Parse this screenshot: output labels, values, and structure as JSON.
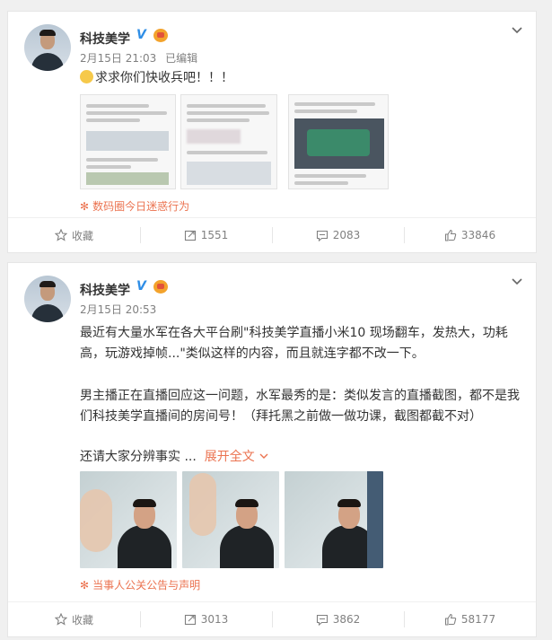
{
  "post1": {
    "username": "科技美学",
    "verified_badge": "V",
    "date": "2月15日 21:03",
    "edited": "已编辑",
    "text": "求求你们快收兵吧！！！",
    "source": "数码圈今日迷惑行为",
    "actions": {
      "favorite": "收藏",
      "repost": "1551",
      "comment": "2083",
      "like": "33846"
    }
  },
  "post2": {
    "username": "科技美学",
    "verified_badge": "V",
    "date": "2月15日 20:53",
    "para1_line1": "最近有大量水军在各大平台刷\"科技美学直播小米10 现场翻车，发热大，功耗",
    "para1_line2": "高，玩游戏掉帧...\"类似这样的内容，而且就连字都不改一下。",
    "para2_line1": "男主播正在直播回应这一问题，水军最秀的是：类似发言的直播截图，都不是我",
    "para2_line2": "们科技美学直播间的房间号！（拜托黑之前做一做功课，截图都截不对）",
    "para3": "还请大家分辨事实 ...",
    "expand": "展开全文",
    "source": "当事人公关公告与声明",
    "actions": {
      "favorite": "收藏",
      "repost": "3013",
      "comment": "3862",
      "like": "58177"
    }
  },
  "colors": {
    "accent": "#eb7350",
    "verified": "#2f8ee6",
    "muted": "#808080"
  },
  "icons": [
    "star-icon",
    "repost-icon",
    "comment-icon",
    "thumbs-up-icon",
    "chevron-down-icon"
  ]
}
